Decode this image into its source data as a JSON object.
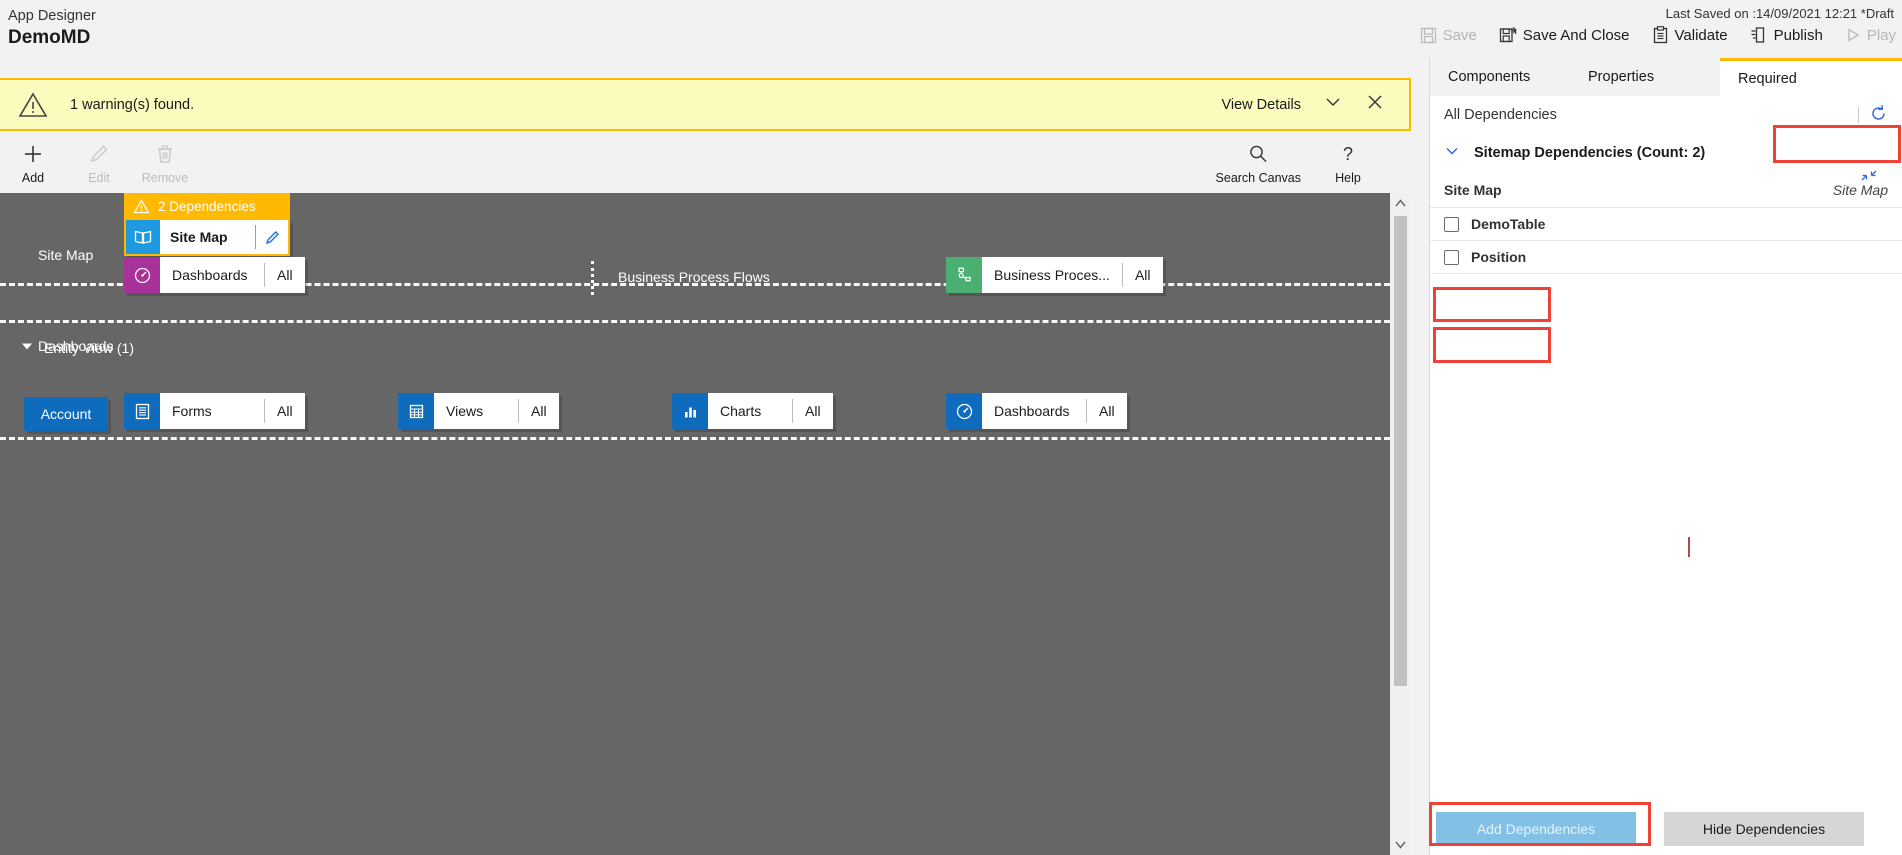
{
  "header": {
    "app_label": "App Designer",
    "app_name": "DemoMD",
    "last_saved": "Last Saved on :14/09/2021 12:21 *Draft",
    "actions": [
      {
        "label": "Save",
        "icon": "save-icon",
        "disabled": true
      },
      {
        "label": "Save And Close",
        "icon": "save-and-close-icon",
        "disabled": false
      },
      {
        "label": "Validate",
        "icon": "validate-clipboard-icon",
        "disabled": false
      },
      {
        "label": "Publish",
        "icon": "publish-icon",
        "disabled": false
      },
      {
        "label": "Play",
        "icon": "play-icon",
        "disabled": true
      }
    ]
  },
  "warning_bar": {
    "icon": "warning-triangle-icon",
    "message": "1 warning(s) found.",
    "view_details_label": "View Details",
    "chevron_icon": "chevron-down-icon",
    "close_icon": "close-icon",
    "background": "#fbfbbd",
    "border": "#ffb900"
  },
  "canvas_toolbar": {
    "left_items": [
      {
        "label": "Add",
        "icon": "plus-icon",
        "disabled": false
      },
      {
        "label": "Edit",
        "icon": "pencil-icon",
        "disabled": true
      },
      {
        "label": "Remove",
        "icon": "trash-icon",
        "disabled": true
      }
    ],
    "right_items": [
      {
        "label": "Search Canvas",
        "icon": "search-icon",
        "disabled": false
      },
      {
        "label": "Help",
        "icon": "question-mark-icon",
        "disabled": false
      }
    ]
  },
  "canvas": {
    "background": "#666666",
    "sitemap_row": {
      "label": "Site Map",
      "dependency_banner": "2 Dependencies",
      "tile_label": "Site Map",
      "tile_icon": "sitemap-book-icon",
      "edit_icon": "pencil-icon",
      "icon_color": "#1e9ae0",
      "banner_color": "#ffb900"
    },
    "dashboards_row": {
      "label": "Dashboards",
      "tile_label": "Dashboards",
      "tile_icon": "gauge-icon",
      "tile_value": "All",
      "icon_color": "#a8329a"
    },
    "bpf_row": {
      "label": "Business Process Flows",
      "tile_label": "Business Proces...",
      "tile_icon": "process-flow-icon",
      "tile_value": "All",
      "icon_color": "#4caf72"
    },
    "entity_view": {
      "header": "Entity View (1)",
      "collapse_icon": "triangle-down-icon",
      "entity_name": "Account",
      "entity_color": "#0f6cbd",
      "tiles": [
        {
          "label": "Forms",
          "icon": "forms-icon",
          "value": "All",
          "icon_color": "#0f6cbd"
        },
        {
          "label": "Views",
          "icon": "views-grid-icon",
          "value": "All",
          "icon_color": "#0f6cbd"
        },
        {
          "label": "Charts",
          "icon": "charts-bar-icon",
          "value": "All",
          "icon_color": "#0f6cbd"
        },
        {
          "label": "Dashboards",
          "icon": "gauge-icon",
          "value": "All",
          "icon_color": "#0f6cbd"
        }
      ]
    }
  },
  "scrollbar": {
    "up_icon": "scroll-up-arrow-icon",
    "down_icon": "scroll-down-arrow-icon"
  },
  "right_panel": {
    "tabs": [
      {
        "label": "Components",
        "active": false
      },
      {
        "label": "Properties",
        "active": false
      },
      {
        "label": "Required",
        "active": true
      }
    ],
    "all_dependencies_label": "All Dependencies",
    "refresh_icon": "refresh-icon",
    "expand_icon": "expand-arrows-icon",
    "group": {
      "label": "Sitemap Dependencies (Count: 2)",
      "chevron_icon": "chevron-down-icon"
    },
    "subheader": {
      "left": "Site Map",
      "right": "Site Map"
    },
    "items": [
      {
        "label": "DemoTable",
        "checked": false
      },
      {
        "label": "Position",
        "checked": false
      }
    ],
    "footer": {
      "add_label": "Add Dependencies",
      "add_disabled": true,
      "hide_label": "Hide Dependencies"
    }
  },
  "annotations": {
    "color": "#ef4136",
    "boxes": [
      "required-tab",
      "demotable-row",
      "position-row",
      "add-dependencies-button"
    ]
  }
}
